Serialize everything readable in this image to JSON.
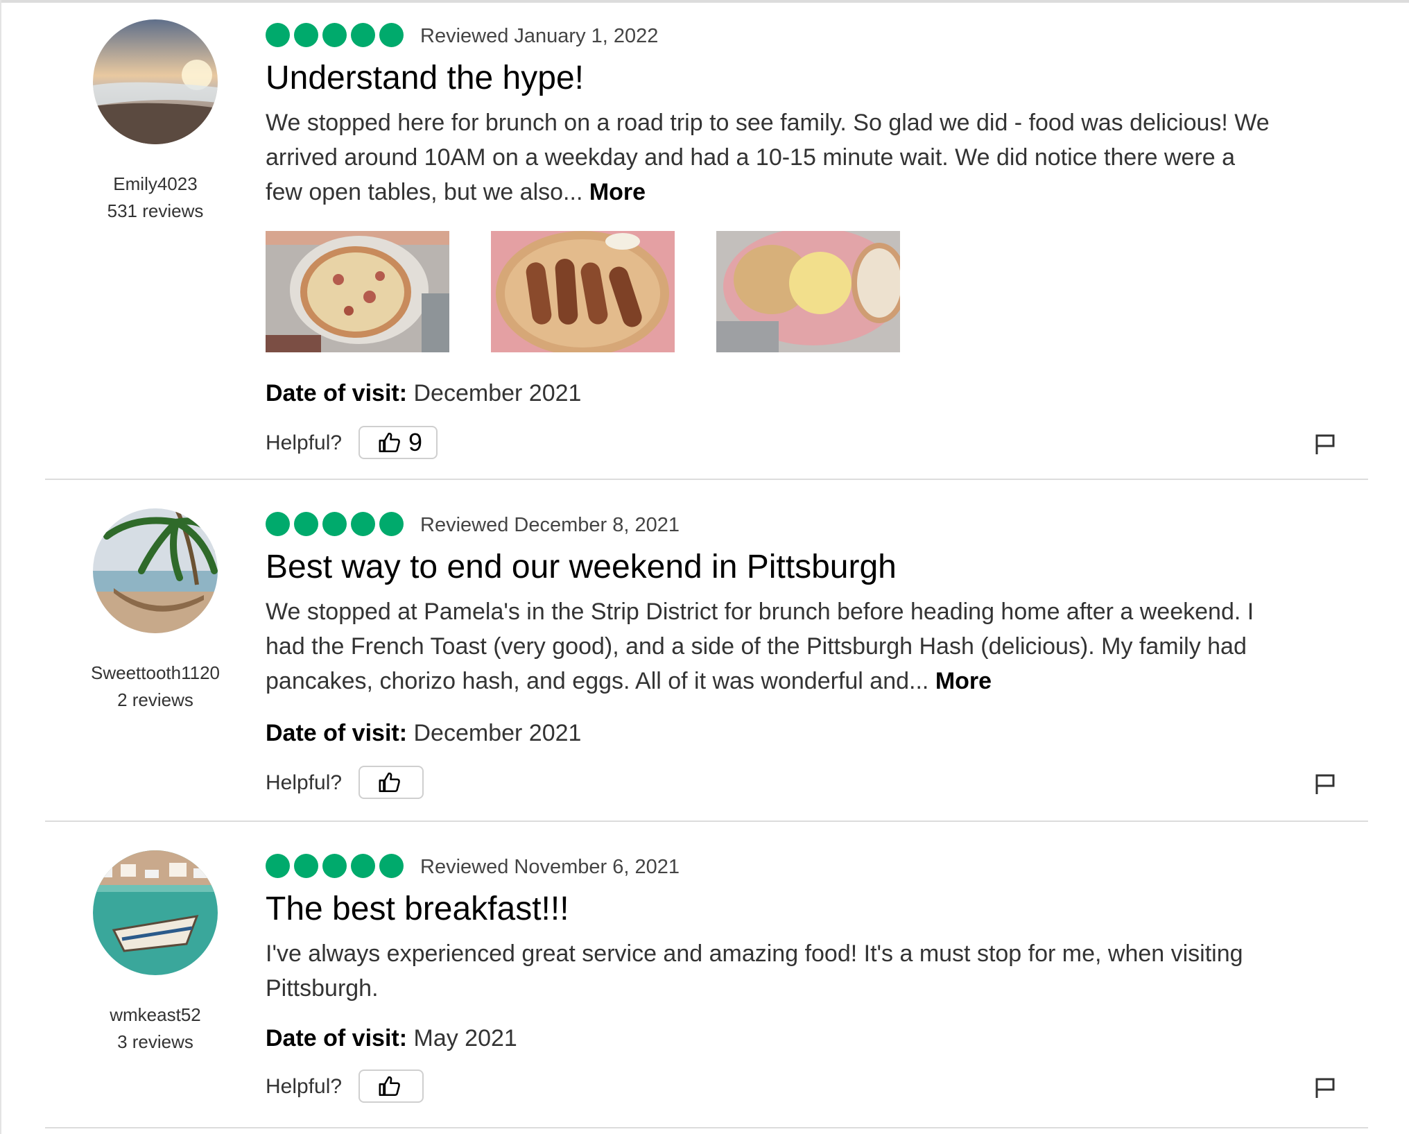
{
  "colors": {
    "rating": "#00aa6c",
    "divider": "#dcdcdc"
  },
  "reviews": [
    {
      "username": "Emily4023",
      "review_count": "531 reviews",
      "rating": 5,
      "reviewed_date": "Reviewed January 1, 2022",
      "title": "Understand the hype!",
      "body": "We stopped here for brunch on a road trip to see family. So glad we did - food was delicious! We arrived around 10AM on a weekday and had a 10-15 minute wait. We did notice there were a few open tables, but we also...",
      "more_label": "More",
      "dov_label": "Date of visit:",
      "dov_value": "December 2021",
      "helpful_label": "Helpful?",
      "helpful_count": "9",
      "avatar_icon": "beach-sunset-avatar",
      "flag_icon": "flag-icon",
      "photos": [
        "pizza-photo",
        "sausage-pancake-photo",
        "eggs-hash-photo"
      ]
    },
    {
      "username": "Sweettooth1120",
      "review_count": "2 reviews",
      "rating": 5,
      "reviewed_date": "Reviewed December 8, 2021",
      "title": "Best way to end our weekend in Pittsburgh",
      "body": "We stopped at Pamela's in the Strip District for brunch before heading home after a weekend. I had the French Toast (very good), and a side of the Pittsburgh Hash (delicious). My family had pancakes, chorizo hash, and eggs. All of it was wonderful and...",
      "more_label": "More",
      "dov_label": "Date of visit:",
      "dov_value": "December 2021",
      "helpful_label": "Helpful?",
      "helpful_count": "",
      "avatar_icon": "palm-hammock-avatar",
      "flag_icon": "flag-icon"
    },
    {
      "username": "wmkeast52",
      "review_count": "3 reviews",
      "rating": 5,
      "reviewed_date": "Reviewed November 6, 2021",
      "title": "The best breakfast!!!",
      "body": "I've always experienced great service and amazing food! It's a must stop for me, when visiting Pittsburgh.",
      "more_label": "",
      "dov_label": "Date of visit:",
      "dov_value": "May 2021",
      "helpful_label": "Helpful?",
      "helpful_count": "",
      "avatar_icon": "boat-harbor-avatar",
      "flag_icon": "flag-icon"
    }
  ]
}
